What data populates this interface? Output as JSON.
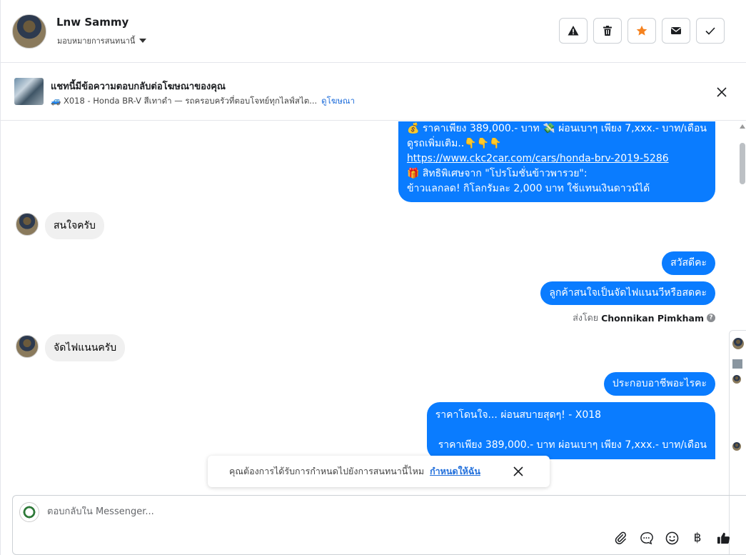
{
  "header": {
    "contact_name": "Lnw Sammy",
    "assign_label": "มอบหมายการสนทนานี้",
    "actions": [
      {
        "name": "report-spam-button",
        "icon": "warning-icon"
      },
      {
        "name": "delete-button",
        "icon": "trash-icon"
      },
      {
        "name": "star-button",
        "icon": "star-icon"
      },
      {
        "name": "mark-unread-button",
        "icon": "envelope-icon"
      },
      {
        "name": "mark-done-button",
        "icon": "check-icon"
      }
    ]
  },
  "ad_banner": {
    "title": "แชทนี้มีข้อความตอบกลับต่อโฆษณาของคุณ",
    "subtitle": "🚙 X018 - Honda BR-V สีเทาดำ — รถครอบครัวที่ตอบโจทย์ทุกไลฟ์สไต...",
    "link": "ดูโฆษณา"
  },
  "messages": {
    "m1_line1": "💰 ราคาเพียง 389,000.- บาท 💸 ผ่อนเบาๆ เพียง 7,xxx.- บาท/เดือน",
    "m1_line2": "ดูรถเพิ่มเติม..👇👇👇",
    "m1_link": "https://www.ckc2car.com/cars/honda-brv-2019-5286",
    "m1_line4": "🎁 สิทธิพิเศษจาก \"โปรโมชั่นข้าวพารวย\":",
    "m1_line5": "ข้าวแลกลด! กิโลกรัมละ 2,000 บาท ใช้แทนเงินดาวน์ได้",
    "in1": "สนใจครับ",
    "out2": "สวัสดีคะ",
    "out3": "ลูกค้าสนใจเป็นจัดไฟแนนวีหรือสดคะ",
    "sent_by_label": "ส่งโดย",
    "sent_by_name": "Chonnikan Pimkham",
    "in2": "จัดไฟแนนครับ",
    "out4": "ประกอบอาชีพอะไรคะ",
    "out5_line1": "ราคาโดนใจ... ผ่อนสบายสุดๆ! - X018",
    "out5_line3": "ราคาเพียง 389,000.- บาท  ผ่อนเบาๆ เพียง 7,xxx.- บาท/เดือน"
  },
  "toast": {
    "text": "คุณต้องการได้รับการกำหนดไปยังการสนทนานี้ไหม",
    "link": "กำหนดให้ฉัน"
  },
  "composer": {
    "placeholder": "ตอบกลับใน Messenger..."
  },
  "colors": {
    "outgoing_bubble": "#0a7cff",
    "incoming_bubble": "#f0f0f0",
    "link": "#216fdb",
    "star": "#f5821f"
  }
}
